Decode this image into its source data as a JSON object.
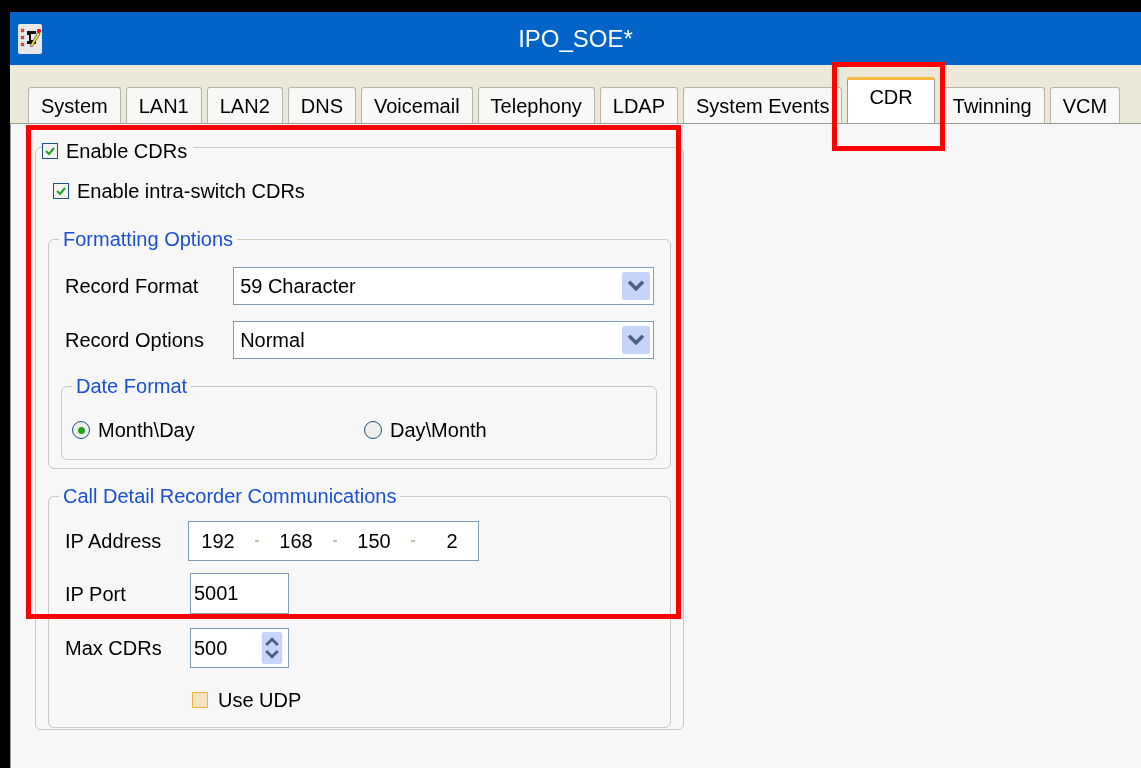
{
  "window": {
    "title": "IPO_SOE*"
  },
  "tabs": [
    {
      "label": "System",
      "selected": false
    },
    {
      "label": "LAN1",
      "selected": false
    },
    {
      "label": "LAN2",
      "selected": false
    },
    {
      "label": "DNS",
      "selected": false
    },
    {
      "label": "Voicemail",
      "selected": false
    },
    {
      "label": "Telephony",
      "selected": false
    },
    {
      "label": "LDAP",
      "selected": false
    },
    {
      "label": "System Events",
      "selected": false
    },
    {
      "label": "CDR",
      "selected": true
    },
    {
      "label": "Twinning",
      "selected": false
    },
    {
      "label": "VCM",
      "selected": false
    }
  ],
  "enable_cdrs": {
    "label": "Enable CDRs",
    "checked": true
  },
  "enable_intra_switch": {
    "label": "Enable intra-switch CDRs",
    "checked": true
  },
  "formatting_options": {
    "title": "Formatting Options",
    "record_format": {
      "label": "Record Format",
      "value": "59 Character"
    },
    "record_options": {
      "label": "Record Options",
      "value": "Normal"
    },
    "date_format": {
      "title": "Date Format",
      "options": [
        {
          "label": "Month\\Day",
          "selected": true
        },
        {
          "label": "Day\\Month",
          "selected": false
        }
      ]
    }
  },
  "communications": {
    "title": "Call Detail Recorder Communications",
    "ip_address": {
      "label": "IP Address",
      "octets": [
        "192",
        "168",
        "150",
        "2"
      ]
    },
    "ip_port": {
      "label": "IP Port",
      "value": "5001"
    },
    "max_cdrs": {
      "label": "Max CDRs",
      "value": "500"
    },
    "use_udp": {
      "label": "Use UDP",
      "checked": false
    }
  }
}
